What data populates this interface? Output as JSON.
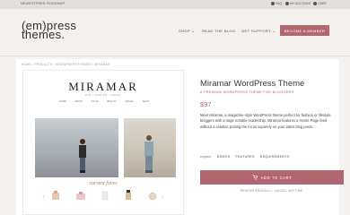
{
  "topbar": {
    "left": [
      "NEWEST",
      "FREE ROADMAP"
    ],
    "right": [
      "FAQ",
      "MY ACCOUNT",
      "CART"
    ]
  },
  "header": {
    "logo_line1": "(em)press",
    "logo_line2": "themes.",
    "nav": [
      "SHOP ⌄",
      "READ THE BLOG",
      "GET SUPPORT ⌄"
    ],
    "cta": "BECOME A MEMBER"
  },
  "breadcrumb": "HOME / PRODUCTS / WORDPRESS THEMES / MIRAMAR",
  "preview": {
    "title": "MIRAMAR",
    "tagline": "LIFE • FASHION • TRAVEL",
    "menu": [
      "HOME",
      "ABOUT",
      "STYLE",
      "BEAUTY",
      "TRAVEL",
      "SHOP"
    ],
    "script_heading": "current faves"
  },
  "product": {
    "title": "Miramar WordPress Theme",
    "subtitle": "A PREMIUM WORDPRESS THEME FOR BLOGGERS",
    "price": "$97",
    "description": "Meet Miramar, a magazine-style WordPress theme perfect for fashion or lifestyle bloggers with a large notable readership. Miramar features a Home Page feed without a sidebar, putting the focus squarely on your latest blog posts.",
    "explore_label": "explore:",
    "explore_links": [
      "DEMOS",
      "FEATURES",
      "REQUIREMENTS"
    ],
    "cart_label": "ADD TO CART",
    "renew_note": "RENEWS ANNUALLY. CANCEL ANYTIME."
  },
  "colors": {
    "accent": "#b2666f",
    "background": "#f4f1ef",
    "topbar": "#e4dfdb"
  },
  "icons": {
    "faq": "question-icon",
    "account": "user-icon",
    "cart": "cart-icon"
  }
}
